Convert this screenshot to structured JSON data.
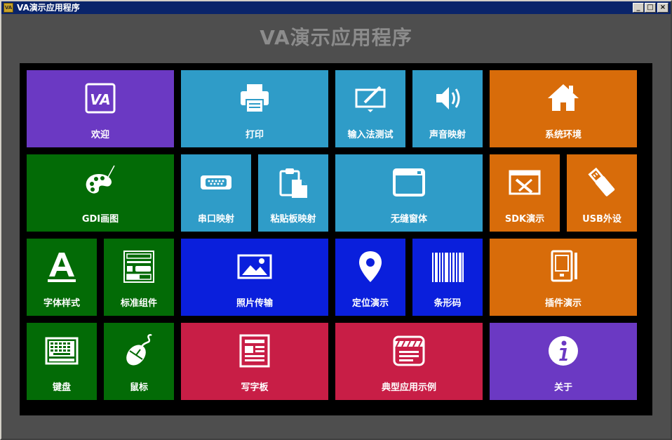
{
  "window": {
    "title": "VA演示应用程序",
    "icon_text": "VA",
    "minimize": "_",
    "maximize": "□",
    "close": "×"
  },
  "app_title": "VA演示应用程序",
  "tiles": {
    "welcome": "欢迎",
    "print": "打印",
    "ime_test": "输入法测试",
    "sound_map": "声音映射",
    "system_env": "系统环境",
    "gdi_paint": "GDI画图",
    "serial_map": "串口映射",
    "clipboard_map": "粘贴板映射",
    "borderless": "无缝窗体",
    "sdk_demo": "SDK演示",
    "usb_device": "USB外设",
    "font_style": "字体样式",
    "std_widgets": "标准组件",
    "photo_transfer": "照片传输",
    "location_demo": "定位演示",
    "barcode": "条形码",
    "plugin_demo": "插件演示",
    "keyboard": "键盘",
    "mouse": "鼠标",
    "notepad": "写字板",
    "typical_apps": "典型应用示例",
    "about": "关于"
  },
  "colors": {
    "purple": "#6b39c3",
    "cyan": "#2f9cc8",
    "orange": "#d86c0a",
    "green": "#036b06",
    "blue": "#0a1fdc",
    "red": "#c81e46",
    "background": "#4e4e4e",
    "titlebar": "#0a246a"
  },
  "icons": {
    "welcome": "va-logo-icon",
    "print": "printer-icon",
    "ime_test": "pen-tablet-icon",
    "sound_map": "speaker-icon",
    "system_env": "home-icon",
    "gdi_paint": "palette-icon",
    "serial_map": "serial-port-icon",
    "clipboard_map": "clipboard-icon",
    "borderless": "window-icon",
    "sdk_demo": "tools-icon",
    "usb_device": "usb-icon",
    "font_style": "font-icon",
    "std_widgets": "widgets-icon",
    "photo_transfer": "photo-icon",
    "location_demo": "map-pin-icon",
    "barcode": "barcode-icon",
    "plugin_demo": "tablet-icon",
    "keyboard": "keyboard-icon",
    "mouse": "mouse-icon",
    "notepad": "document-icon",
    "typical_apps": "film-icon",
    "about": "info-icon"
  }
}
